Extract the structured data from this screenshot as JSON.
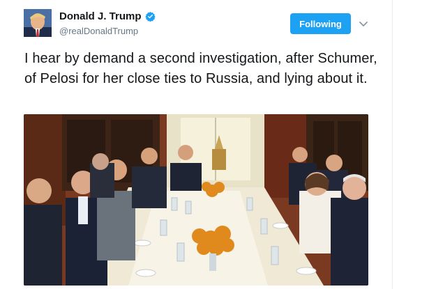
{
  "tweet": {
    "author": {
      "display_name": "Donald J. Trump",
      "handle": "@realDonaldTrump",
      "verified_icon": "verified-badge-icon",
      "avatar": "avatar-icon"
    },
    "follow_button_label": "Following",
    "menu_icon": "chevron-down-icon",
    "text": "I hear by demand a second investigation, after Schumer, of Pelosi for her close ties to Russia, and lying about it.",
    "media": "photo"
  },
  "colors": {
    "accent": "#1da1f2",
    "text": "#14171a",
    "secondary": "#657786"
  }
}
